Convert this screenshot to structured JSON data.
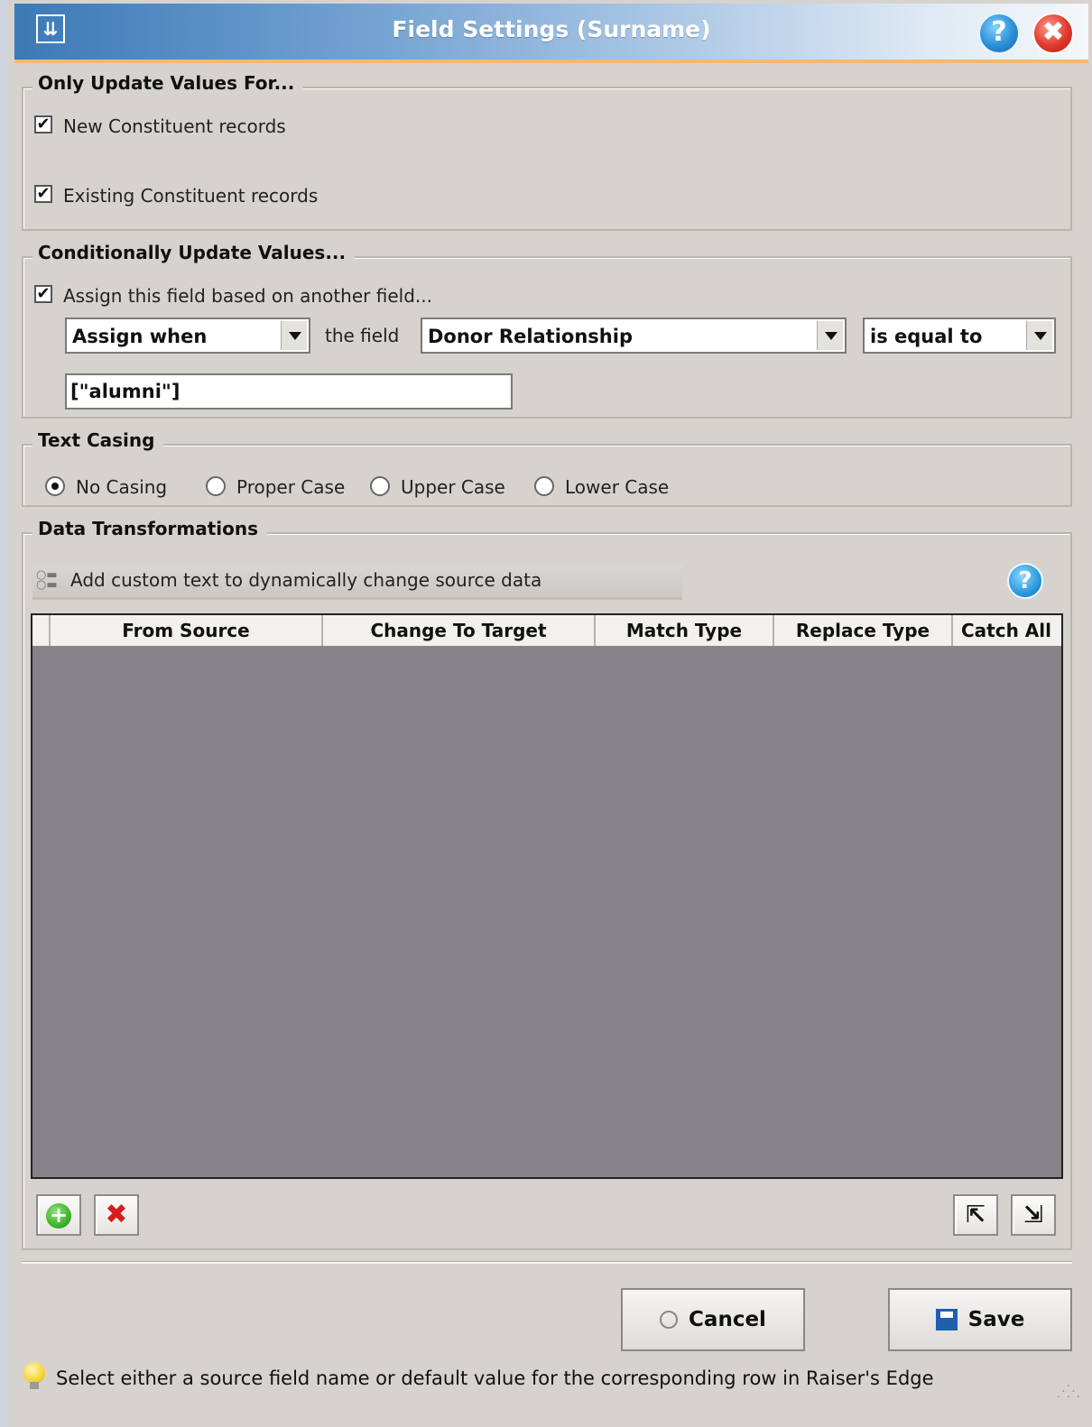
{
  "window": {
    "title": "Field Settings (Surname)",
    "icon": "sliders-icon",
    "help_icon": "?",
    "close_icon": "✖"
  },
  "only_update": {
    "title": "Only Update Values For...",
    "new_records": {
      "label": "New Constituent records",
      "checked": true
    },
    "existing_records": {
      "label": "Existing Constituent records",
      "checked": true
    }
  },
  "conditional": {
    "title": "Conditionally Update Values...",
    "assign_check": {
      "label": "Assign this field based on another field...",
      "checked": true
    },
    "assign_when": "Assign when",
    "the_field_label": "the field",
    "field": "Donor Relationship",
    "operator": "is equal to",
    "value": "[\"alumni\"]"
  },
  "text_casing": {
    "title": "Text Casing",
    "options": [
      "No Casing",
      "Proper Case",
      "Upper Case",
      "Lower Case"
    ],
    "selected": "No Casing"
  },
  "data_transformations": {
    "title": "Data Transformations",
    "hint": "Add custom text to dynamically change source data",
    "columns": [
      "From Source",
      "Change To Target",
      "Match Type",
      "Replace Type",
      "Catch All"
    ],
    "rows": []
  },
  "buttons": {
    "cancel": "Cancel",
    "save": "Save"
  },
  "status": {
    "text": "Select either a source field name or default value for the corresponding row in Raiser's Edge"
  },
  "colors": {
    "accent_orange": "#f3b872",
    "title_blue": "#3c79b6",
    "grid_bg": "#858387"
  }
}
